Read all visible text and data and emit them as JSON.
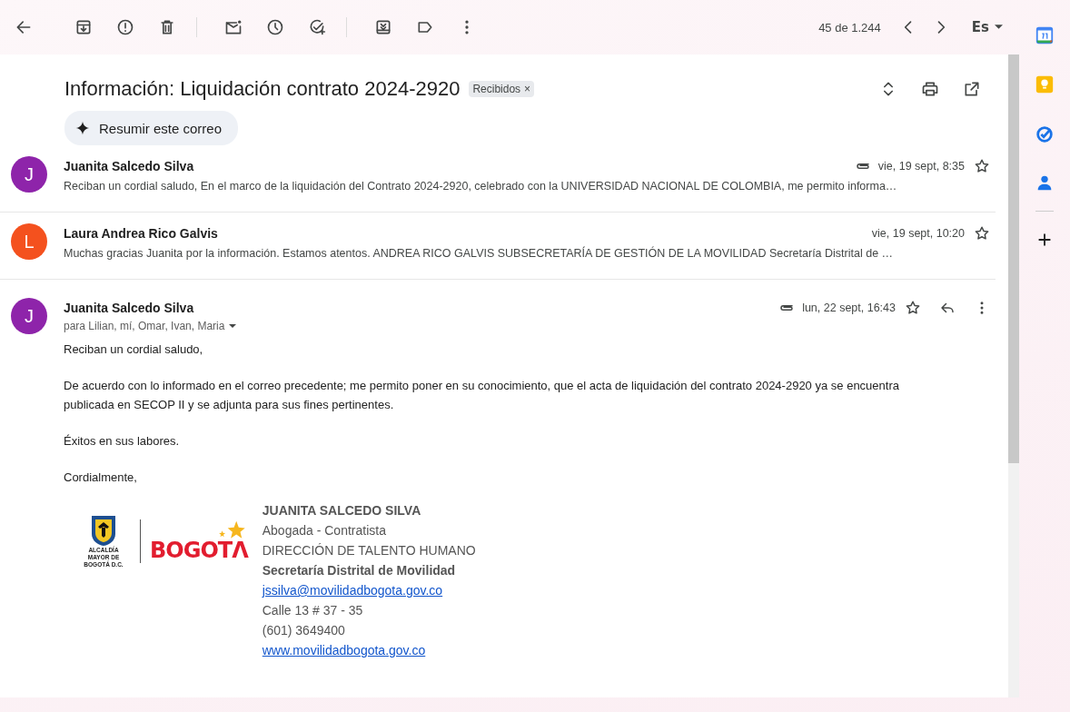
{
  "toolbar": {
    "counter": "45 de 1.244",
    "language": "Es"
  },
  "thread": {
    "subject": "Información: Liquidación contrato 2024-2920",
    "label": "Recibidos",
    "label_close": "×",
    "summarize": "Resumir este correo"
  },
  "messages": [
    {
      "kind": "collapsed",
      "initial": "J",
      "color": "#8e24aa",
      "sender": "Juanita Salcedo Silva",
      "snippet": "Reciban un cordial saludo, En el marco de la liquidación del Contrato 2024-2920, celebrado con la UNIVERSIDAD NACIONAL DE COLOMBIA, me permito informa…",
      "date": "vie, 19 sept, 8:35",
      "has_attachment": true,
      "starred": false
    },
    {
      "kind": "collapsed",
      "initial": "L",
      "color": "#f4511e",
      "sender": "Laura Andrea Rico Galvis",
      "snippet": "Muchas gracias Juanita por la información. Estamos atentos. ANDREA RICO GALVIS SUBSECRETARÍA DE GESTIÓN DE LA MOVILIDAD Secretaría Distrital de …",
      "date": "vie, 19 sept, 10:20",
      "has_attachment": false,
      "starred": false
    },
    {
      "kind": "expanded",
      "initial": "J",
      "color": "#8e24aa",
      "sender": "Juanita Salcedo Silva",
      "recipients": "para Lilian, mí, Omar, Ivan, Maria",
      "date": "lun, 22 sept, 16:43",
      "has_attachment": true,
      "starred": false,
      "body": [
        "Reciban un cordial saludo,",
        "De acuerdo con lo informado en el correo precedente; me permito poner en su conocimiento, que el acta de liquidación del contrato 2024-2920 ya se encuentra publicada en SECOP II y se adjunta para sus fines pertinentes.",
        "Éxitos en sus labores.",
        "Cordialmente,"
      ],
      "signature": {
        "logo_caption": "ALCALDÍA MAYOR DE BOGOTÁ D.C.",
        "logo_word": "BOGOTΛ",
        "lines": [
          {
            "kind": "bold",
            "text": "JUANITA SALCEDO SILVA"
          },
          {
            "kind": "plain",
            "text": "Abogada - Contratista"
          },
          {
            "kind": "plain",
            "text": "DIRECCIÓN DE TALENTO HUMANO"
          },
          {
            "kind": "bold",
            "text": "Secretaría Distrital de Movilidad"
          },
          {
            "kind": "link",
            "text": "jssilva@movilidadbogota.gov.co"
          },
          {
            "kind": "plain",
            "text": "Calle 13 # 37 - 35"
          },
          {
            "kind": "plain",
            "text": "(601) 3649400"
          },
          {
            "kind": "link",
            "text": "www.movilidadbogota.gov.co"
          }
        ]
      }
    }
  ]
}
